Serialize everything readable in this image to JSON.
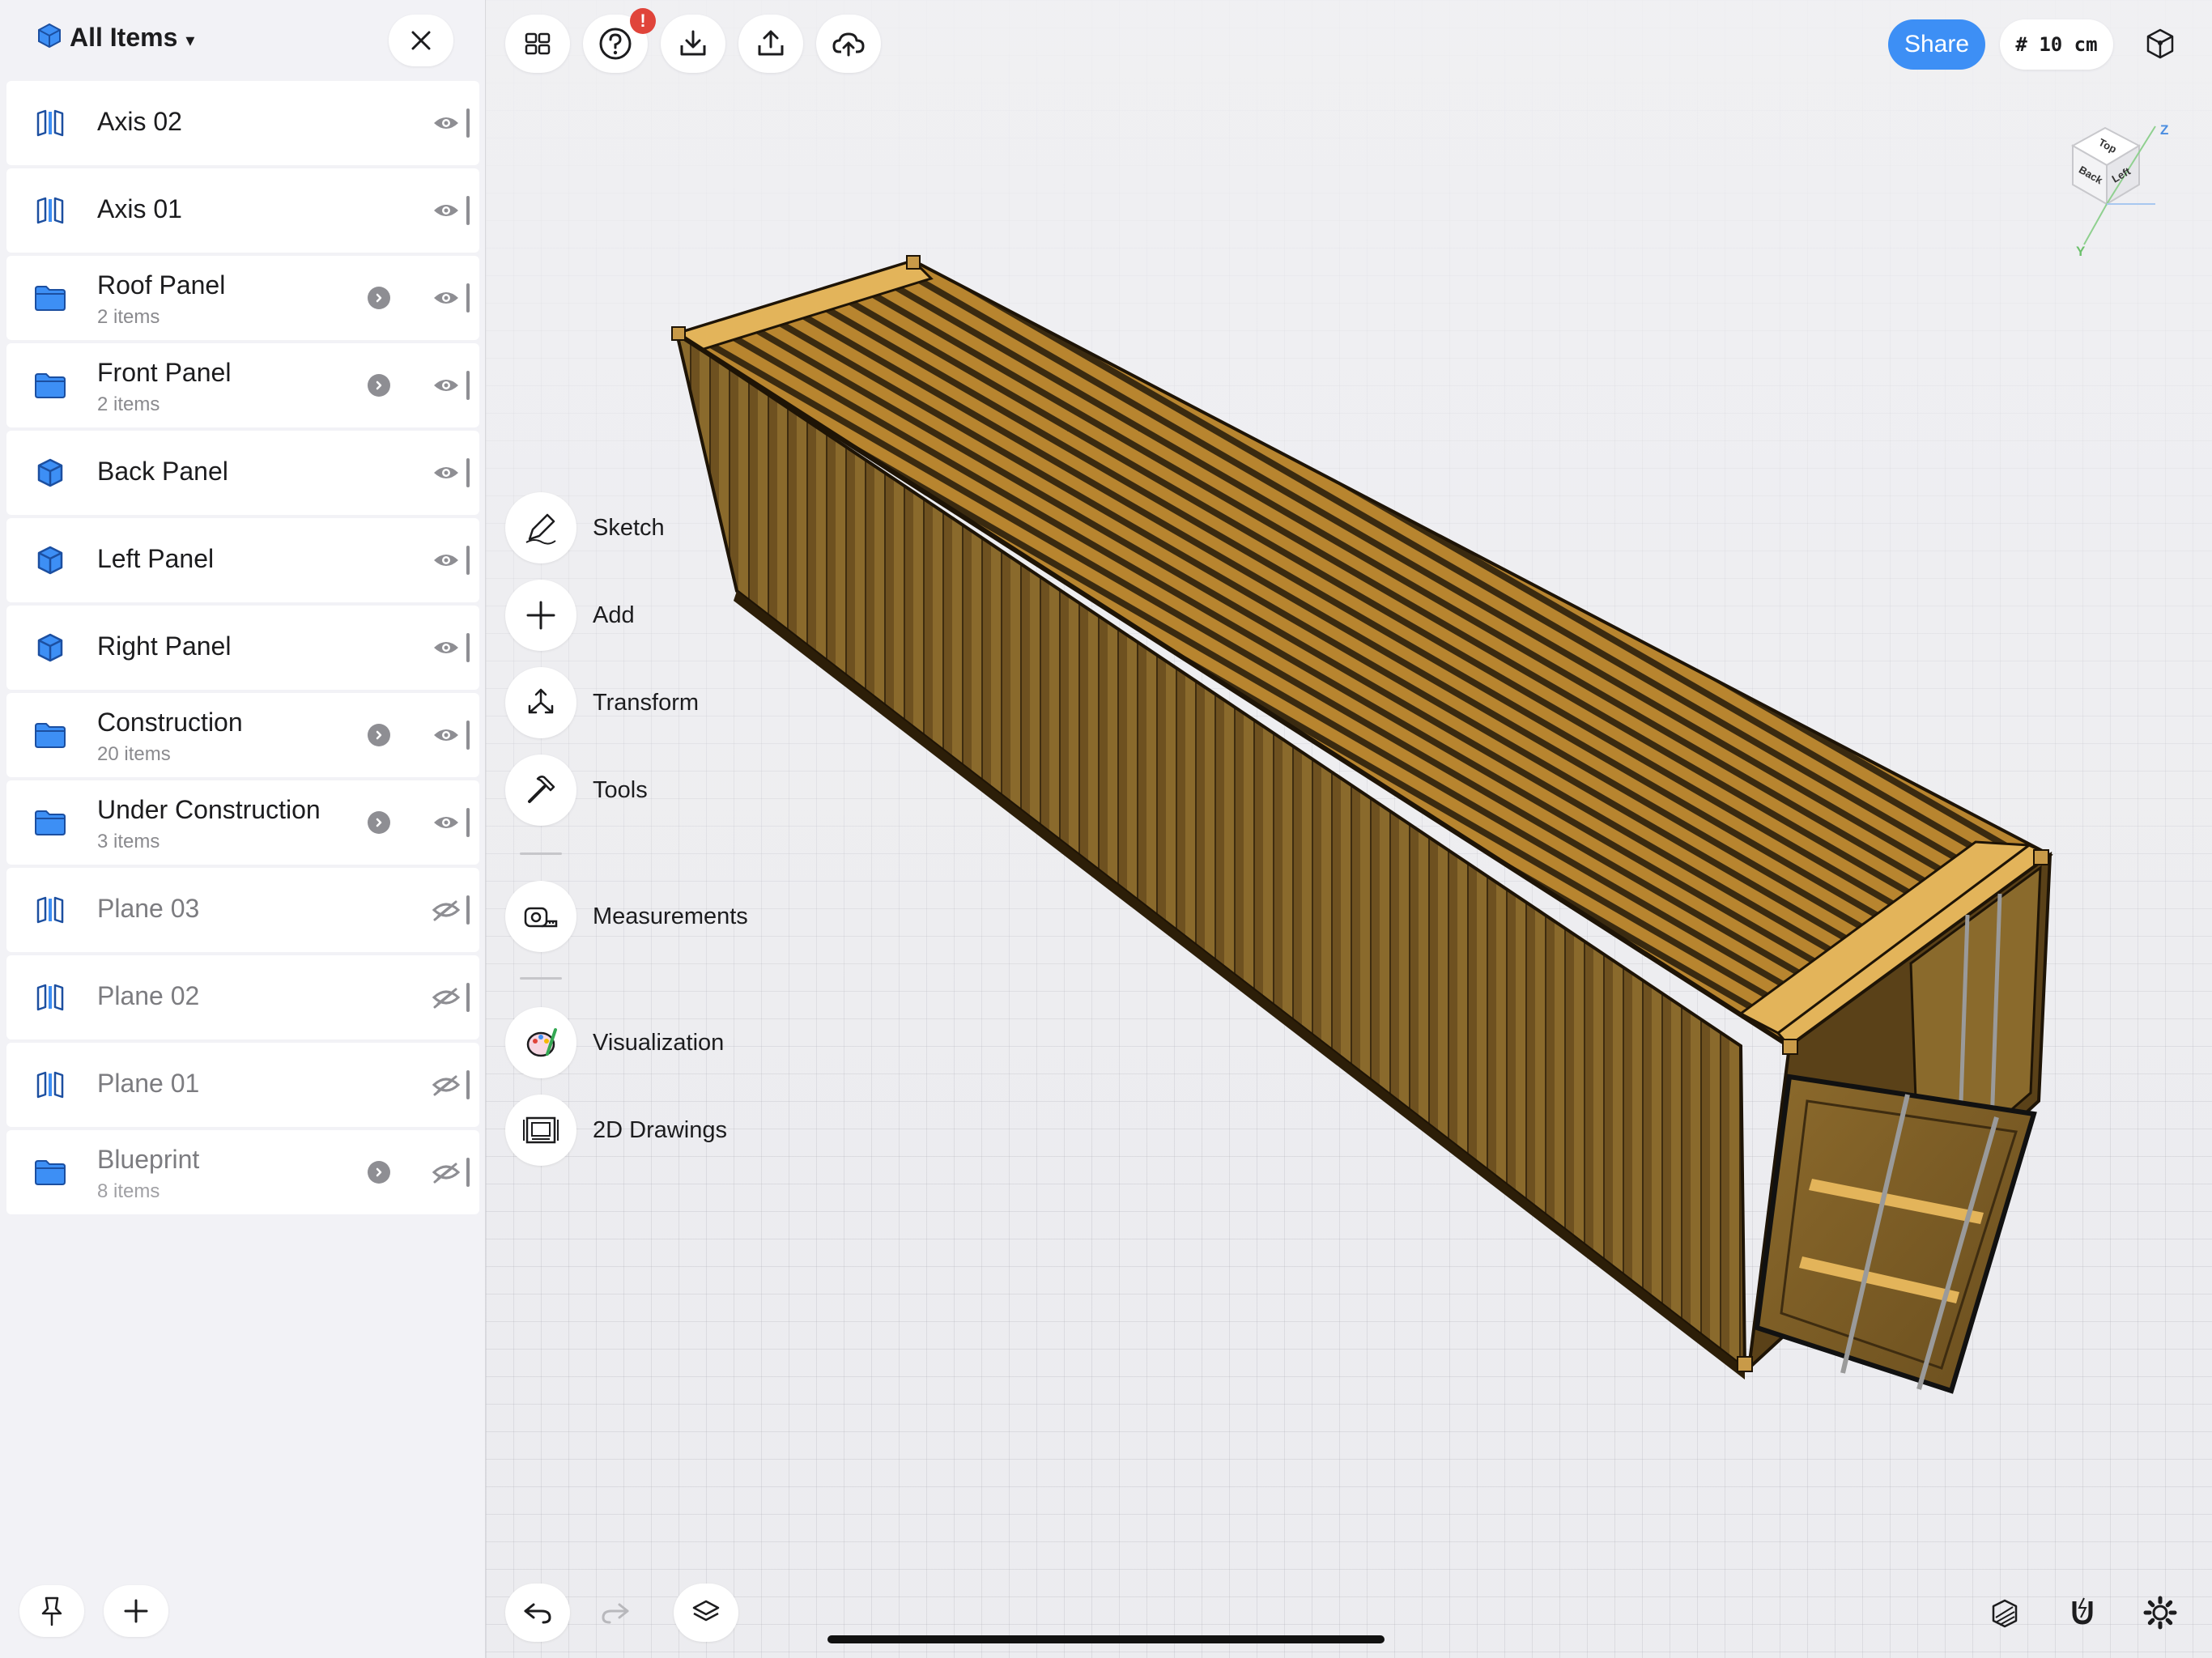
{
  "sidebar": {
    "title": "All Items",
    "items": [
      {
        "name": "Axis 02",
        "sub": "",
        "type": "plane",
        "has_arrow": false,
        "hidden": false
      },
      {
        "name": "Axis 01",
        "sub": "",
        "type": "plane",
        "has_arrow": false,
        "hidden": false
      },
      {
        "name": "Roof Panel",
        "sub": "2 items",
        "type": "folder",
        "has_arrow": true,
        "hidden": false
      },
      {
        "name": "Front Panel",
        "sub": "2 items",
        "type": "folder",
        "has_arrow": true,
        "hidden": false
      },
      {
        "name": "Back Panel",
        "sub": "",
        "type": "solid",
        "has_arrow": false,
        "hidden": false
      },
      {
        "name": "Left Panel",
        "sub": "",
        "type": "solid",
        "has_arrow": false,
        "hidden": false
      },
      {
        "name": "Right Panel",
        "sub": "",
        "type": "solid",
        "has_arrow": false,
        "hidden": false
      },
      {
        "name": "Construction",
        "sub": "20 items",
        "type": "folder",
        "has_arrow": true,
        "hidden": false
      },
      {
        "name": "Under Construction",
        "sub": "3 items",
        "type": "folder",
        "has_arrow": true,
        "hidden": false
      },
      {
        "name": "Plane 03",
        "sub": "",
        "type": "plane",
        "has_arrow": false,
        "hidden": true
      },
      {
        "name": "Plane 02",
        "sub": "",
        "type": "plane",
        "has_arrow": false,
        "hidden": true
      },
      {
        "name": "Plane 01",
        "sub": "",
        "type": "plane",
        "has_arrow": false,
        "hidden": true
      },
      {
        "name": "Blueprint",
        "sub": "8 items",
        "type": "folder",
        "has_arrow": true,
        "hidden": true
      }
    ]
  },
  "toolbar": {
    "help_badge": "!",
    "share_label": "Share",
    "grid_label": "# 10 cm"
  },
  "navcube": {
    "top": "Top",
    "back": "Back",
    "left": "Left",
    "z": "Z",
    "y": "Y"
  },
  "tools": [
    {
      "label": "Sketch",
      "icon": "pen-icon"
    },
    {
      "label": "Add",
      "icon": "plus-icon"
    },
    {
      "label": "Transform",
      "icon": "transform-icon"
    },
    {
      "label": "Tools",
      "icon": "hammer-icon"
    },
    {
      "label": "Measurements",
      "icon": "tape-measure-icon"
    },
    {
      "label": "Visualization",
      "icon": "palette-icon"
    },
    {
      "label": "2D Drawings",
      "icon": "blueprint-icon"
    }
  ],
  "colors": {
    "accent": "#3d8ff5",
    "folder": "#3d8ff5",
    "container_wall": "#7a5a22",
    "container_roof": "#e3b45a",
    "badge": "#e0443a"
  }
}
